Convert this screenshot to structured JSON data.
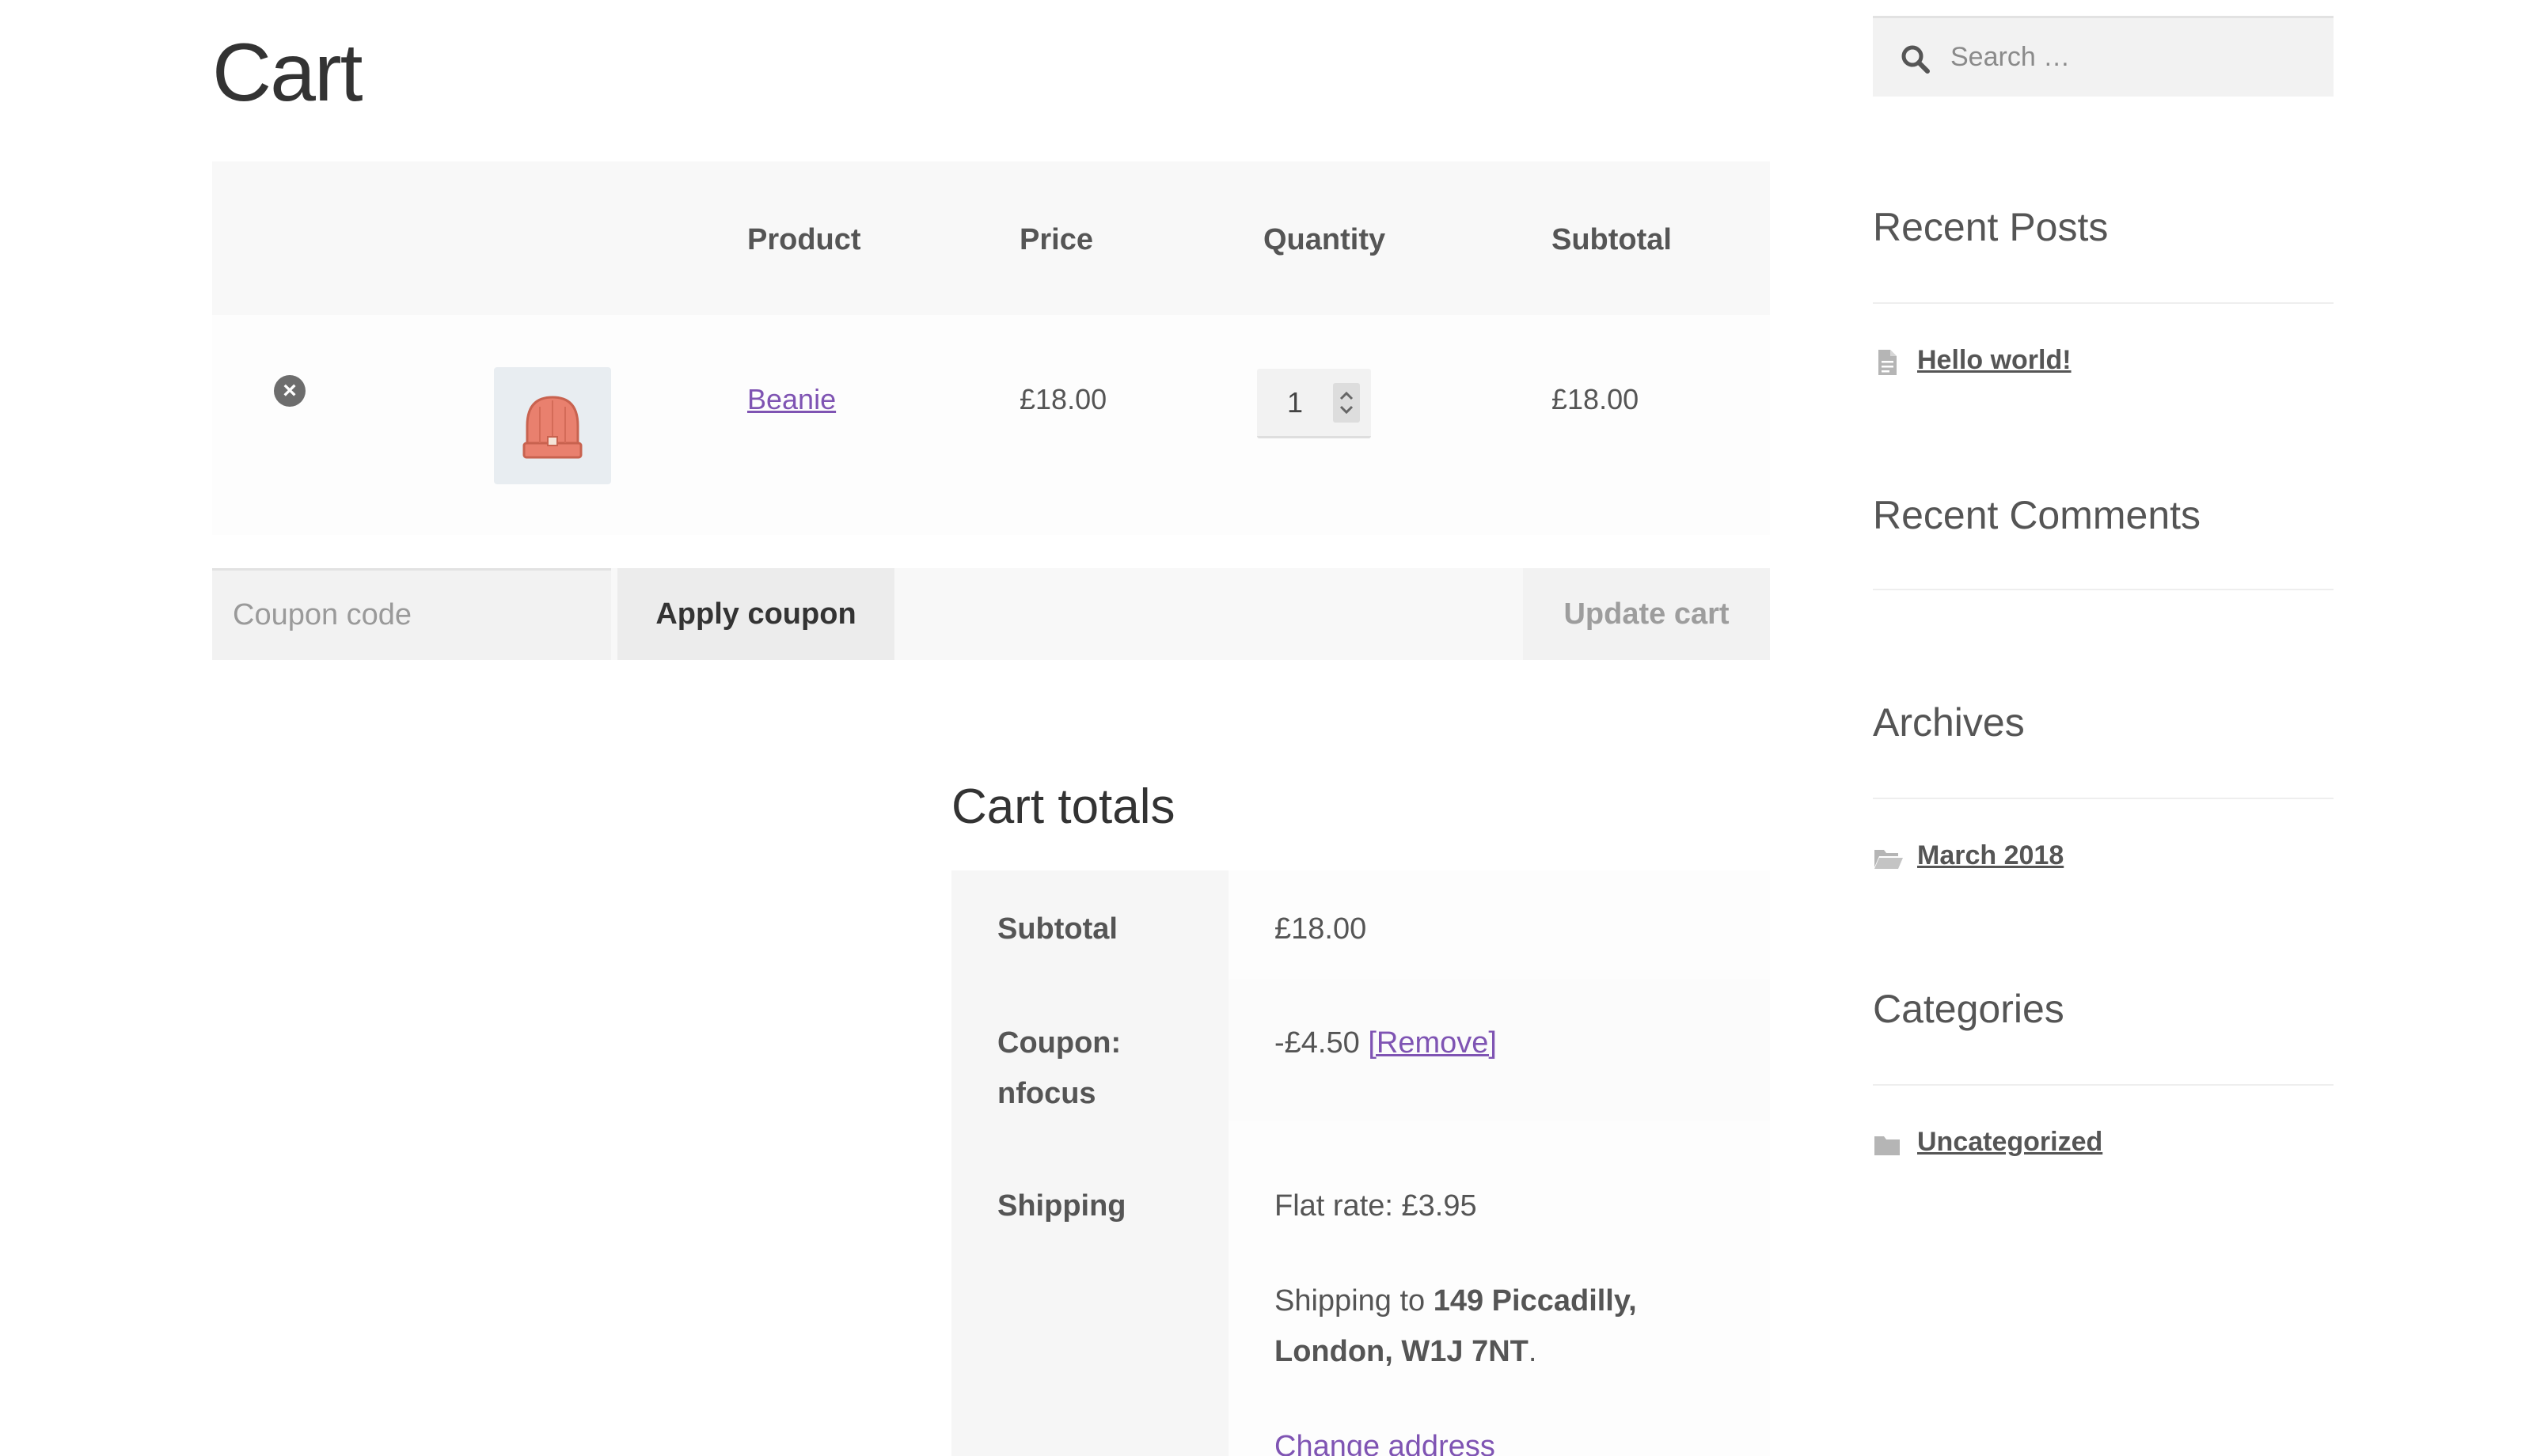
{
  "page": {
    "title": "Cart"
  },
  "cart_table": {
    "headers": {
      "product": "Product",
      "price": "Price",
      "quantity": "Quantity",
      "subtotal": "Subtotal"
    },
    "rows": [
      {
        "remove_symbol": "×",
        "product_name": "Beanie",
        "price": "£18.00",
        "quantity": "1",
        "subtotal": "£18.00",
        "thumbnail_icon": "beanie-icon"
      }
    ]
  },
  "actions": {
    "coupon_placeholder": "Coupon code",
    "apply_coupon_label": "Apply coupon",
    "update_cart_label": "Update cart"
  },
  "cart_totals": {
    "title": "Cart totals",
    "subtotal_label": "Subtotal",
    "subtotal_value": "£18.00",
    "coupon_label_line1": "Coupon:",
    "coupon_label_line2": "nfocus",
    "coupon_discount": "-£4.50",
    "coupon_remove_label": "[Remove]",
    "shipping_label": "Shipping",
    "shipping_method": "Flat rate: £3.95",
    "shipping_to_prefix": "Shipping to",
    "shipping_address_line1": "149 Piccadilly,",
    "shipping_address_line2": "London, W1J 7NT",
    "shipping_address_suffix": ".",
    "change_address_label": "Change address"
  },
  "sidebar": {
    "search_placeholder": "Search …",
    "recent_posts": {
      "title": "Recent Posts",
      "items": [
        {
          "label": "Hello world!",
          "icon": "document-icon"
        }
      ]
    },
    "recent_comments": {
      "title": "Recent Comments"
    },
    "archives": {
      "title": "Archives",
      "items": [
        {
          "label": "March 2018",
          "icon": "folder-open-icon"
        }
      ]
    },
    "categories": {
      "title": "Categories",
      "items": [
        {
          "label": "Uncategorized",
          "icon": "folder-icon"
        }
      ]
    }
  },
  "colors": {
    "link_purple": "#7f54b3",
    "text_gray": "#555555",
    "table_header_bg": "#f8f8f8"
  }
}
